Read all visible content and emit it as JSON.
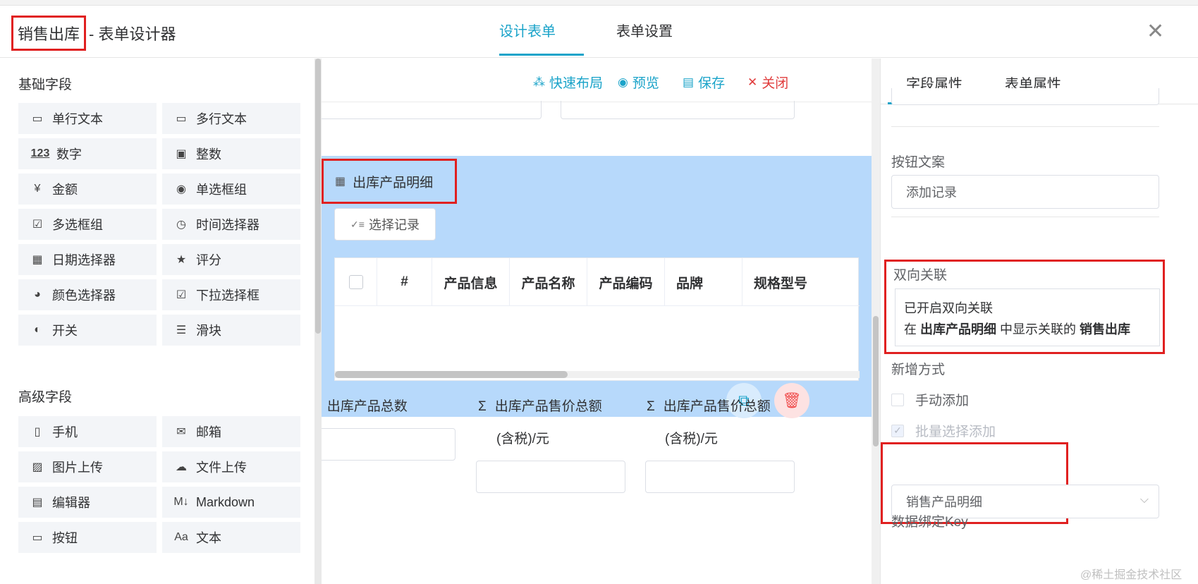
{
  "header": {
    "title_highlight": "销售出库",
    "title_rest": "- 表单设计器",
    "tabs": [
      "设计表单",
      "表单设置"
    ],
    "close": "✕"
  },
  "left_panel": {
    "basic_title": "基础字段",
    "basic_fields": [
      {
        "label": "单行文本",
        "icon": "single-line-text-icon",
        "glyph": "▭"
      },
      {
        "label": "多行文本",
        "icon": "multi-line-text-icon",
        "glyph": "▭"
      },
      {
        "label": "数字",
        "icon": "number-icon",
        "glyph": "123"
      },
      {
        "label": "整数",
        "icon": "integer-icon",
        "glyph": "▣"
      },
      {
        "label": "金额",
        "icon": "amount-icon",
        "glyph": "¥"
      },
      {
        "label": "单选框组",
        "icon": "radio-icon",
        "glyph": "◉"
      },
      {
        "label": "多选框组",
        "icon": "checkbox-icon",
        "glyph": "☑"
      },
      {
        "label": "时间选择器",
        "icon": "clock-icon",
        "glyph": "◷"
      },
      {
        "label": "日期选择器",
        "icon": "calendar-icon",
        "glyph": "▦"
      },
      {
        "label": "评分",
        "icon": "star-icon",
        "glyph": "★"
      },
      {
        "label": "颜色选择器",
        "icon": "palette-icon",
        "glyph": "◕"
      },
      {
        "label": "下拉选择框",
        "icon": "select-icon",
        "glyph": "☑"
      },
      {
        "label": "开关",
        "icon": "switch-icon",
        "glyph": "◐"
      },
      {
        "label": "滑块",
        "icon": "slider-icon",
        "glyph": "☰"
      }
    ],
    "advanced_title": "高级字段",
    "advanced_fields": [
      {
        "label": "手机",
        "icon": "phone-icon",
        "glyph": "▯"
      },
      {
        "label": "邮箱",
        "icon": "mail-icon",
        "glyph": "✉"
      },
      {
        "label": "图片上传",
        "icon": "image-upload-icon",
        "glyph": "▨"
      },
      {
        "label": "文件上传",
        "icon": "file-upload-icon",
        "glyph": "☁"
      },
      {
        "label": "编辑器",
        "icon": "editor-icon",
        "glyph": "▤"
      },
      {
        "label": "Markdown",
        "icon": "markdown-icon",
        "glyph": "M↓"
      },
      {
        "label": "按钮",
        "icon": "button-icon",
        "glyph": "▭"
      },
      {
        "label": "文本",
        "icon": "text-icon",
        "glyph": "Aa"
      }
    ]
  },
  "toolbar": {
    "quick_layout": "快速布局",
    "preview": "预览",
    "save": "保存",
    "close": "关闭"
  },
  "subform": {
    "label": "出库产品明细",
    "select_button": "选择记录",
    "columns": [
      "#",
      "产品信息",
      "产品名称",
      "产品编码",
      "品牌",
      "规格型号"
    ]
  },
  "summary": {
    "fields": [
      {
        "label": "出库产品总数",
        "sub": ""
      },
      {
        "label": "出库产品售价总额",
        "sub": "(含税)/元"
      },
      {
        "label": "出库产品售价总额",
        "sub": "(含税)/元"
      }
    ],
    "sigma": "Σ"
  },
  "right_panel": {
    "tabs": [
      "字段属性",
      "表单属性"
    ],
    "button_text_label": "按钮文案",
    "button_text_value": "添加记录",
    "bidirectional_label": "双向关联",
    "bidirectional_line1": "已开启双向关联",
    "bidirectional_prefix": "在",
    "bidirectional_source": "出库产品明细",
    "bidirectional_middle": "中显示关联的",
    "bidirectional_target": "销售出库",
    "add_mode_label": "新增方式",
    "manual_add": "手动添加",
    "batch_add": "批量选择添加",
    "batch_select_value": "销售产品明细",
    "data_key_label": "数据绑定Key"
  },
  "watermark": "@稀土掘金技术社区",
  "colors": {
    "accent": "#1aa3c9",
    "highlight_border": "#e02020",
    "subform_bg": "#b7d9fb",
    "danger": "#e03c3c"
  }
}
